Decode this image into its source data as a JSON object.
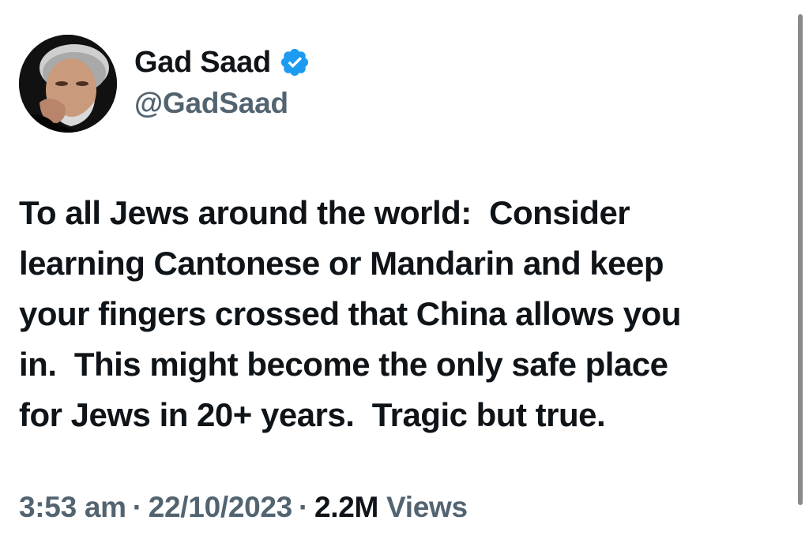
{
  "author": {
    "display_name": "Gad Saad",
    "handle": "@GadSaad",
    "verified": true,
    "verified_color": "#1d9bf0"
  },
  "tweet": {
    "lines": [
      "To all Jews around the world:  Consider",
      "learning Cantonese or Mandarin and keep",
      "your fingers crossed that China allows you",
      "in.  This might become the only safe place",
      "for Jews in 20+ years.  Tragic but true."
    ]
  },
  "meta": {
    "time": "3:53 am",
    "separator": "·",
    "date": "22/10/2023",
    "views_count": "2.2M",
    "views_label": "Views"
  },
  "icons": {
    "avatar": "profile-photo",
    "verified": "verified-badge-icon"
  }
}
